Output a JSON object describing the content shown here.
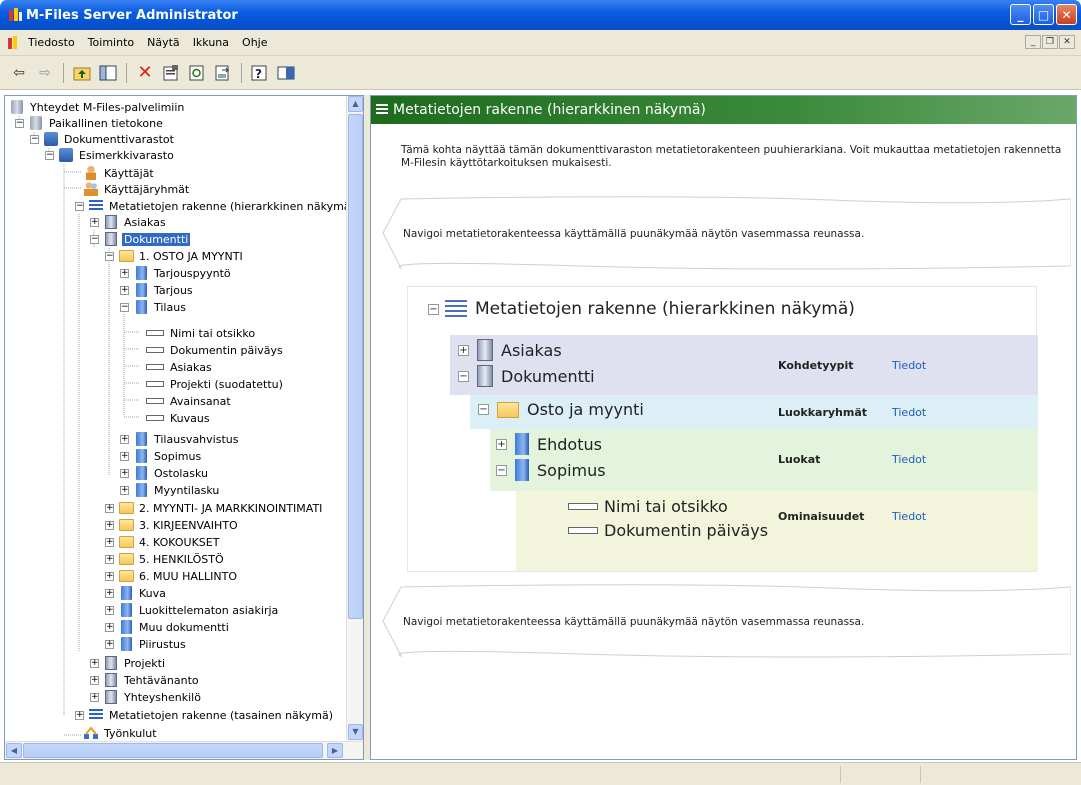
{
  "window": {
    "title": "M-Files Server Administrator"
  },
  "menu": {
    "items": [
      "Tiedosto",
      "Toiminto",
      "Näytä",
      "Ikkuna",
      "Ohje"
    ]
  },
  "toolbar": {
    "icons": [
      "back-icon",
      "forward-icon",
      "up-folder-icon",
      "show-hide-tree-icon",
      "delete-icon",
      "properties-icon",
      "refresh-icon",
      "export-icon",
      "help-icon",
      "panel-icon"
    ]
  },
  "tree": {
    "root": "Yhteydet M-Files-palvelimiin",
    "local": "Paikallinen tietokone",
    "vaults": "Dokumenttivarastot",
    "sample": "Esimerkkivarasto",
    "users": "Käyttäjät",
    "groups": "Käyttäjäryhmät",
    "meta_hier": "Metatietojen rakenne (hierarkkinen näkymä",
    "asiakas": "Asiakas",
    "dokumentti": "Dokumentti",
    "osto": "1. OSTO JA MYYNTI",
    "tarjouspyynto": "Tarjouspyyntö",
    "tarjous": "Tarjous",
    "tilaus": "Tilaus",
    "p1": "Nimi tai otsikko",
    "p2": "Dokumentin päiväys",
    "p3": "Asiakas",
    "p4": "Projekti (suodatettu)",
    "p5": "Avainsanat",
    "p6": "Kuvaus",
    "tilausvahvistus": "Tilausvahvistus",
    "sopimus": "Sopimus",
    "ostolasku": "Ostolasku",
    "myyntilasku": "Myyntilasku",
    "g2": "2. MYYNTI- JA MARKKINOINTIMATI",
    "g3": "3. KIRJEENVAIHTO",
    "g4": "4. KOKOUKSET",
    "g5": "5. HENKILÖSTÖ",
    "g6": "6. MUU HALLINTO",
    "kuva": "Kuva",
    "luokittelematon": "Luokittelematon asiakirja",
    "muu": "Muu dokumentti",
    "piirustus": "Piirustus",
    "projekti": "Projekti",
    "tehtavananto": "Tehtävänanto",
    "yhteyshenkilo": "Yhteyshenkilö",
    "meta_flat": "Metatietojen rakenne (tasainen näkymä)",
    "workflows": "Työnkulut"
  },
  "right": {
    "header": "Metatietojen rakenne (hierarkkinen näkymä)",
    "intro": "Tämä kohta näyttää tämän dokumenttivaraston metatietorakenteen puuhierarkiana. Voit mukauttaa metatietojen rakennetta M-Filesin käyttötarkoituksen mukaisesti.",
    "nav_hint_top": "Navigoi metatietorakenteessa käyttämällä puunäkymää näytön vasemmassa reunassa.",
    "nav_hint_bottom": "Navigoi metatietorakenteessa käyttämällä puunäkymää näytön vasemmassa reunassa.",
    "diagram": {
      "title": "Metatietojen rakenne (hierarkkinen näkymä)",
      "asiakas": "Asiakas",
      "dokumentti": "Dokumentti",
      "osto": "Osto ja myynti",
      "ehdotus": "Ehdotus",
      "sopimus": "Sopimus",
      "nimi": "Nimi tai otsikko",
      "paivays": "Dokumentin päiväys",
      "cat_objtypes": "Kohdetyypit",
      "cat_classgroups": "Luokkaryhmät",
      "cat_classes": "Luokat",
      "cat_props": "Ominaisuudet",
      "info": "Tiedot"
    }
  },
  "colors": {
    "titlebar": "#0a5ee0",
    "header_green": "#2e7d2e",
    "selection": "#316ac5",
    "band_objtypes": "#dfe0f0",
    "band_classgroups": "#dceef6",
    "band_classes": "#e3f3dc",
    "band_props": "#f2f4dc",
    "link": "#2060b8"
  }
}
